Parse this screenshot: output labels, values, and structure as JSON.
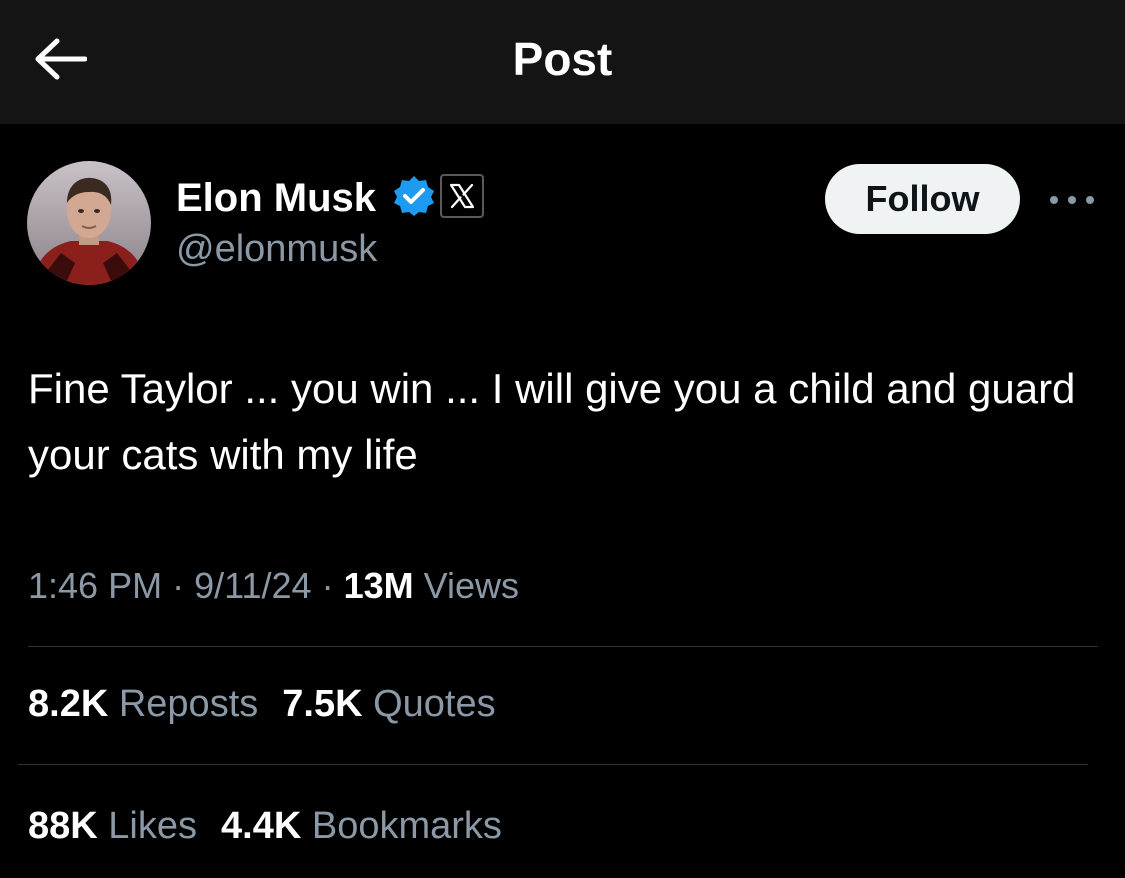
{
  "header": {
    "title": "Post",
    "back_icon": "arrow-left-icon"
  },
  "author": {
    "name": "Elon Musk",
    "handle": "@elonmusk",
    "verified_icon": "verified-badge-icon",
    "affiliate_icon": "x-logo-icon",
    "verified_color": "#1d9bf0"
  },
  "actions": {
    "follow_label": "Follow",
    "more_icon": "more-options-icon"
  },
  "post": {
    "text": "Fine Taylor ... you win ... I will give you a child and guard your cats with my life"
  },
  "meta": {
    "time": "1:46 PM",
    "separator": "·",
    "date": "9/11/24",
    "views_count": "13M",
    "views_label": "Views"
  },
  "stats": {
    "reposts_count": "8.2K",
    "reposts_label": "Reposts",
    "quotes_count": "7.5K",
    "quotes_label": "Quotes",
    "likes_count": "88K",
    "likes_label": "Likes",
    "bookmarks_count": "4.4K",
    "bookmarks_label": "Bookmarks"
  },
  "colors": {
    "background": "#000000",
    "header_background": "#141414",
    "text_primary": "#ffffff",
    "text_secondary": "#8b98a5",
    "divider": "#2f3336",
    "follow_button_bg": "#eff3f4"
  }
}
